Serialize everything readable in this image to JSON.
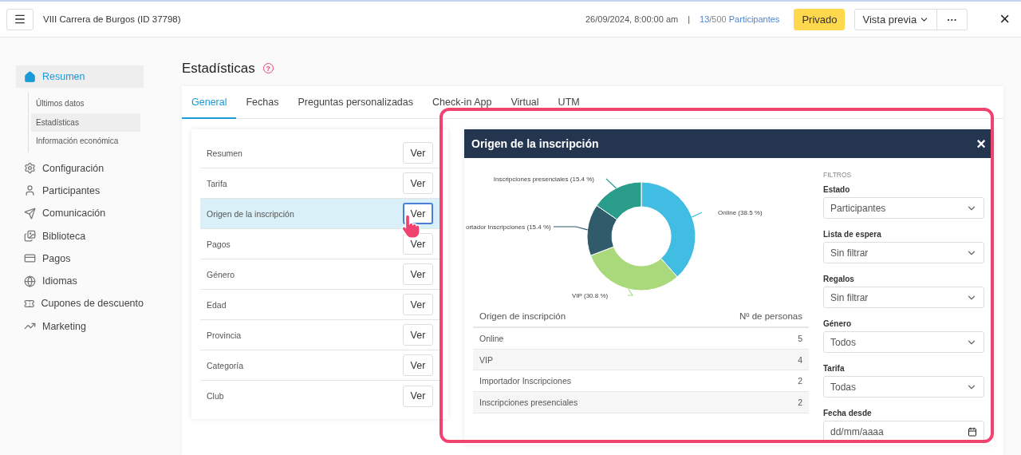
{
  "header": {
    "title": "VIII Carrera de Burgos (ID 37798)",
    "date": "26/09/2024, 8:00:00 am",
    "separator": "|",
    "participants": {
      "count": "13",
      "total": "/500",
      "label": "Participantes"
    },
    "visibility": "Privado",
    "preview": "Vista previa",
    "more": "···",
    "close": "×"
  },
  "sidebar": {
    "items": [
      {
        "label": "Resumen",
        "selected": true,
        "children": [
          {
            "label": "Últimos datos",
            "selected": false
          },
          {
            "label": "Estadísticas",
            "selected": true
          },
          {
            "label": "Información económica",
            "selected": false
          }
        ]
      },
      {
        "label": "Configuración",
        "selected": false
      },
      {
        "label": "Participantes",
        "selected": false
      },
      {
        "label": "Comunicación",
        "selected": false
      },
      {
        "label": "Biblioteca",
        "selected": false
      },
      {
        "label": "Pagos",
        "selected": false
      },
      {
        "label": "Idiomas",
        "selected": false
      },
      {
        "label": "Cupones de descuento",
        "selected": false
      },
      {
        "label": "Marketing",
        "selected": false
      }
    ]
  },
  "page": {
    "title": "Estadísticas",
    "help": "?"
  },
  "tabs": [
    {
      "label": "General",
      "selected": true
    },
    {
      "label": "Fechas",
      "selected": false
    },
    {
      "label": "Preguntas personalizadas",
      "selected": false
    },
    {
      "label": "Check-in App",
      "selected": false
    },
    {
      "label": "Virtual",
      "selected": false
    },
    {
      "label": "UTM",
      "selected": false
    }
  ],
  "stats": [
    {
      "label": "Resumen",
      "button": "Ver",
      "selected": false
    },
    {
      "label": "Tarifa",
      "button": "Ver",
      "selected": false
    },
    {
      "label": "Origen de la inscripción",
      "button": "Ver",
      "selected": true
    },
    {
      "label": "Pagos",
      "button": "Ver",
      "selected": false
    },
    {
      "label": "Género",
      "button": "Ver",
      "selected": false
    },
    {
      "label": "Edad",
      "button": "Ver",
      "selected": false
    },
    {
      "label": "Provincia",
      "button": "Ver",
      "selected": false
    },
    {
      "label": "Categoría",
      "button": "Ver",
      "selected": false
    },
    {
      "label": "Club",
      "button": "Ver",
      "selected": false
    }
  ],
  "modal": {
    "title": "Origen de la inscripción",
    "close": "×",
    "chart": {
      "chart_data": {
        "type": "donut",
        "categories": [
          "Online (38.5 %)",
          "VIP (30.8 %)",
          "ortador Inscripciones (15.4 %)",
          "Inscripciones presenciales (15.4 %)"
        ],
        "values": [
          38.5,
          30.8,
          15.4,
          15.4
        ],
        "colors": [
          "#41bde3",
          "#a9d97b",
          "#2f5b6b",
          "#2a9d8a"
        ]
      }
    },
    "table": {
      "columns": [
        "Origen de inscripción",
        "Nº de personas"
      ],
      "rows": [
        [
          "Online",
          "5"
        ],
        [
          "VIP",
          "4"
        ],
        [
          "Importador Inscripciones",
          "2"
        ],
        [
          "Inscripciones presenciales",
          "2"
        ]
      ]
    },
    "filters": {
      "heading": "FILTROS",
      "fields": [
        {
          "kind": "select",
          "label": "Estado",
          "value": "Participantes"
        },
        {
          "kind": "select",
          "label": "Lista de espera",
          "value": "Sin filtrar"
        },
        {
          "kind": "select",
          "label": "Regalos",
          "value": "Sin filtrar"
        },
        {
          "kind": "select",
          "label": "Género",
          "value": "Todos"
        },
        {
          "kind": "select",
          "label": "Tarifa",
          "value": "Todas"
        },
        {
          "kind": "date",
          "label": "Fecha desde",
          "placeholder": "dd/mm/aaaa"
        }
      ]
    }
  }
}
